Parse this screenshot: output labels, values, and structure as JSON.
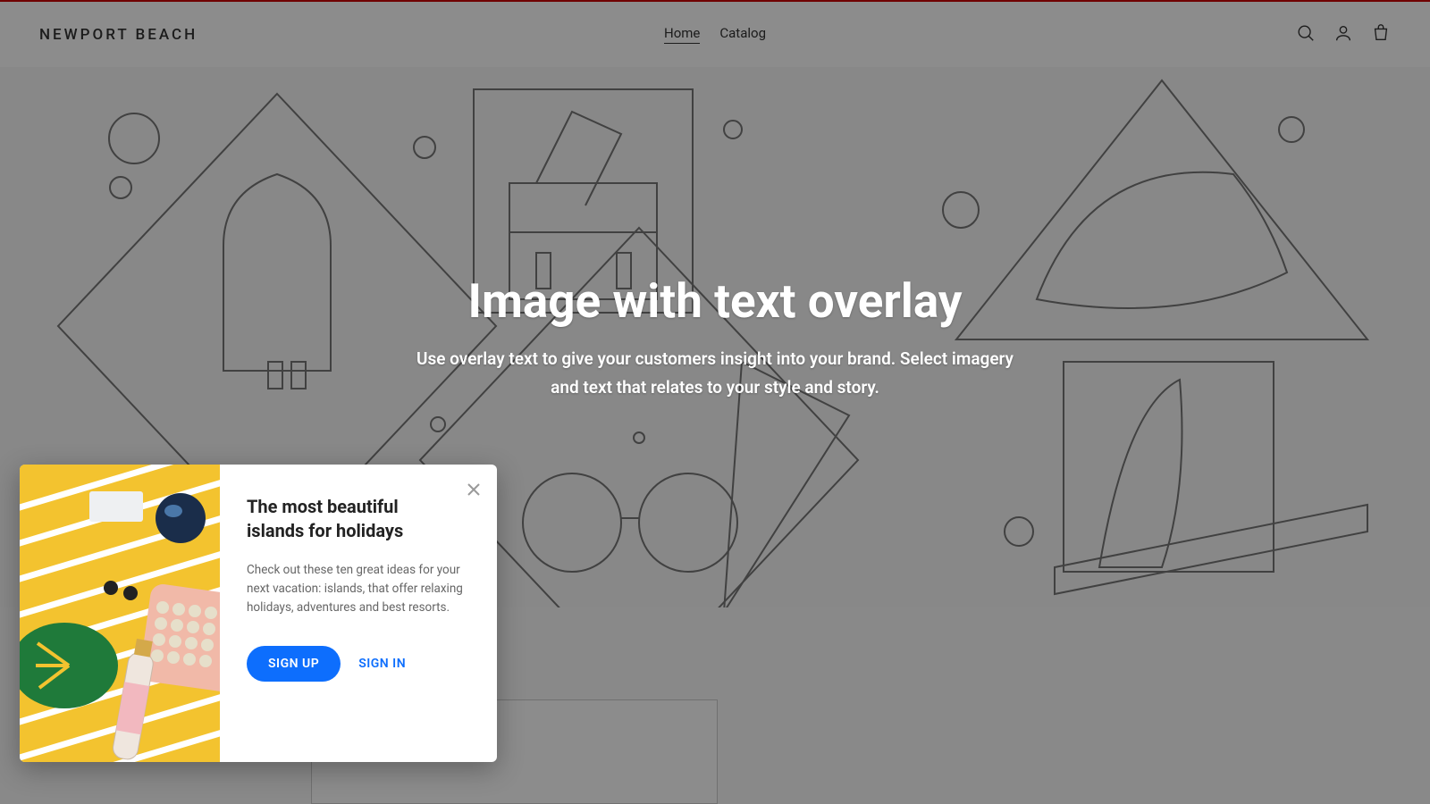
{
  "header": {
    "brand": "NEWPORT BEACH",
    "nav": {
      "home": "Home",
      "catalog": "Catalog"
    }
  },
  "hero": {
    "title": "Image with text overlay",
    "subtitle": "Use overlay text to give your customers insight into your brand. Select imagery and text that relates to your style and story."
  },
  "popup": {
    "title": "The most beautiful islands for holidays",
    "desc": "Check out these ten great ideas for your next vacation: islands, that offer relaxing holidays, adventures and best resorts.",
    "primary": "SIGN UP",
    "secondary": "SIGN IN"
  }
}
